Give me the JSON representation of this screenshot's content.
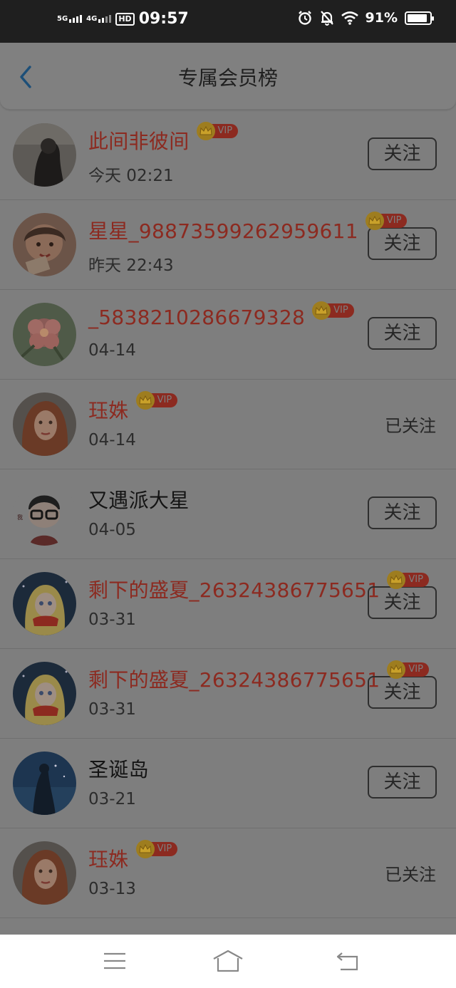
{
  "status": {
    "time": "09:57",
    "net1": "5G",
    "net2": "4G",
    "hd": "HD",
    "battery": "91%",
    "battery_level": 0.91
  },
  "header": {
    "title": "专属会员榜"
  },
  "vip_label": "VIP",
  "members": [
    {
      "name": "此间非彼间",
      "vip": true,
      "date": "今天 02:21",
      "action": "关注",
      "followed": false,
      "avatar": "girl-dark"
    },
    {
      "name": "星星_98873599262959611",
      "vip": true,
      "date": "昨天 22:43",
      "action": "关注",
      "followed": false,
      "avatar": "child"
    },
    {
      "name": "_5838210286679328",
      "vip": true,
      "date": "04-14",
      "action": "关注",
      "followed": false,
      "avatar": "flower"
    },
    {
      "name": "珏姝",
      "vip": true,
      "date": "04-14",
      "action": "已关注",
      "followed": true,
      "avatar": "woman-red"
    },
    {
      "name": "又遇派大星",
      "vip": false,
      "date": "04-05",
      "action": "关注",
      "followed": false,
      "avatar": "cartoon-glasses"
    },
    {
      "name": "剩下的盛夏_26324386775651",
      "vip": true,
      "date": "03-31",
      "action": "关注",
      "followed": false,
      "avatar": "anime-girl"
    },
    {
      "name": "剩下的盛夏_26324386775651",
      "vip": true,
      "date": "03-31",
      "action": "关注",
      "followed": false,
      "avatar": "anime-girl"
    },
    {
      "name": "圣诞岛",
      "vip": false,
      "date": "03-21",
      "action": "关注",
      "followed": false,
      "avatar": "night-sky"
    },
    {
      "name": "珏姝",
      "vip": true,
      "date": "03-13",
      "action": "已关注",
      "followed": true,
      "avatar": "woman-red"
    }
  ],
  "colors": {
    "vip_name": "#8c2a20",
    "overlay": "#7e7e7e",
    "status_bar": "#1f1f1f",
    "nav_bar": "#ffffff"
  }
}
